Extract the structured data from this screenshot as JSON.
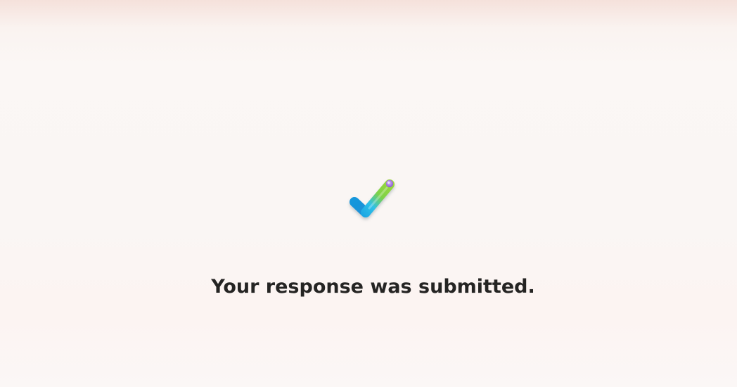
{
  "confirmation": {
    "icon": "checkmark-icon",
    "message": "Your response was submitted."
  },
  "colors": {
    "text": "#252423",
    "check_blue": "#1aa6e0",
    "check_green": "#8ecb3a",
    "check_purple": "#9b6ad6"
  }
}
